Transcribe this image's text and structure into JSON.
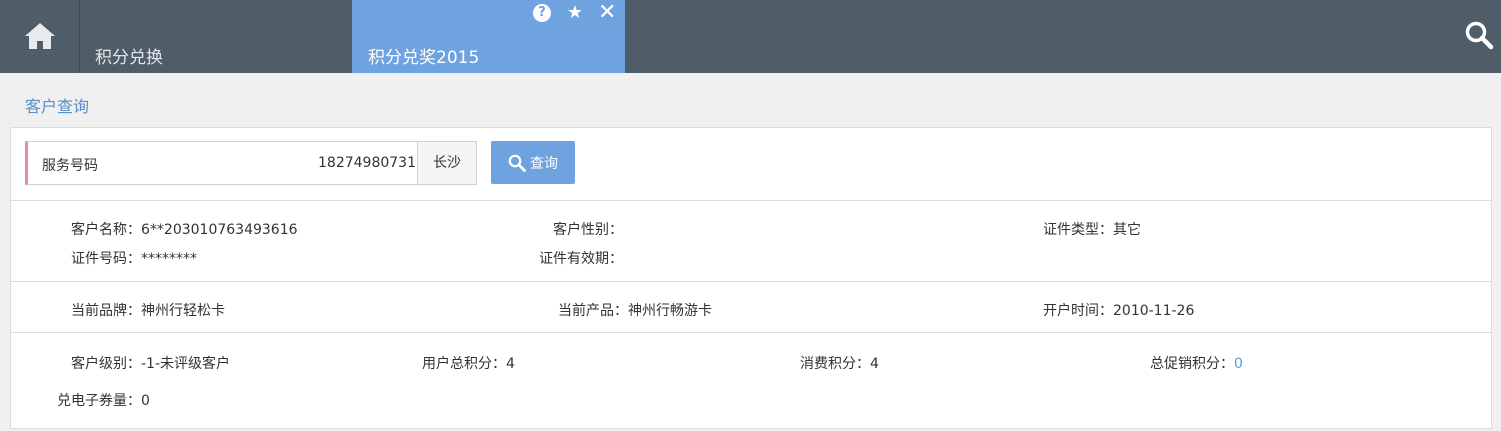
{
  "tabs": [
    {
      "label": "积分兑换"
    },
    {
      "label": "积分兑奖2015"
    }
  ],
  "tab_controls": {
    "help": "?",
    "star": "★",
    "close": "✕"
  },
  "section_title": "客户查询",
  "query": {
    "label": "服务号码",
    "value": "18274980731",
    "city": "长沙",
    "button": "查询"
  },
  "info_row1": {
    "name_label": "客户名称：",
    "name_value": "6**203010763493616",
    "gender_label": "客户性别：",
    "gender_value": "",
    "idtype_label": "证件类型：",
    "idtype_value": "其它"
  },
  "info_row2": {
    "idno_label": "证件号码：",
    "idno_value": "********",
    "validity_label": "证件有效期：",
    "validity_value": ""
  },
  "info_row3": {
    "brand_label": "当前品牌：",
    "brand_value": "神州行轻松卡",
    "product_label": "当前产品：",
    "product_value": "神州行畅游卡",
    "open_label": "开户时间：",
    "open_value": "2010-11-26"
  },
  "points": {
    "level_label": "客户级别：",
    "level_value": "-1-未评级客户",
    "total_label": "用户总积分：",
    "total_value": "4",
    "consume_label": "消费积分：",
    "consume_value": "4",
    "promo_label": "总促销积分：",
    "promo_value": "0",
    "coupon_label": "兑电子券量：",
    "coupon_value": "0"
  },
  "colors": {
    "accent": "#6fa3e0",
    "topbar": "#4f5d69",
    "link": "#5b9bd5",
    "input_accent": "#e68bb0"
  }
}
